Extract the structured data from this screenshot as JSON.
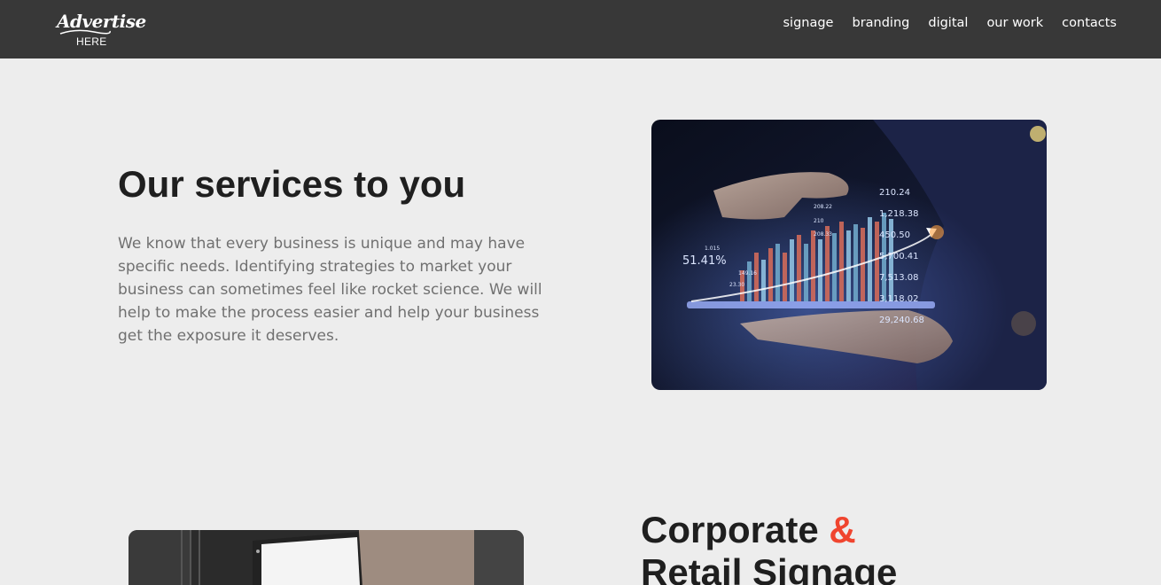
{
  "header": {
    "logo_script": "Advertise",
    "logo_sub": "HERE",
    "nav": [
      "signage",
      "branding",
      "digital",
      "our work",
      "contacts"
    ]
  },
  "services": {
    "title": "Our services to you",
    "body": "We know that every business is unique and may have specific needs. Identifying strategies to market your business can sometimes feel like rocket science. We will help to make the process easier and help your business get the exposure it deserves."
  },
  "hero_image": {
    "percent": "51.41%",
    "numbers": [
      "210.24",
      "1,218.38",
      "450.50",
      "5,700.41",
      "7,513.08",
      "3,118.02",
      "29,240.68"
    ],
    "small_numbers": [
      "1.015",
      "149.16",
      "23.30",
      "208.22",
      "210",
      "208.33"
    ]
  },
  "signage": {
    "title_part1": "Corporate ",
    "amp": "&",
    "title_line2": "Retail Signage"
  },
  "colors": {
    "header_bg": "#383838",
    "page_bg": "#ededed",
    "accent": "#f0452f"
  }
}
